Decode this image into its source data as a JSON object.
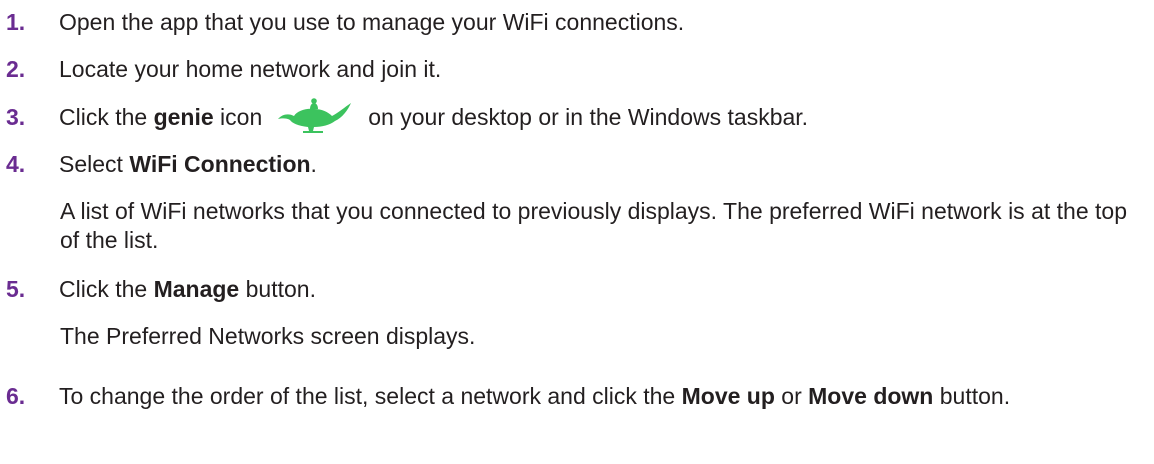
{
  "steps": [
    {
      "number": "1.",
      "text": "Open the app that you use to manage your WiFi connections."
    },
    {
      "number": "2.",
      "text": "Locate your home network and join it."
    },
    {
      "number": "3.",
      "prefix": "Click the ",
      "bold": "genie",
      "middle": " icon",
      "icon": "genie-lamp-icon",
      "suffix": "on your desktop or in the Windows taskbar."
    },
    {
      "number": "4.",
      "prefix": "Select ",
      "bold": "WiFi Connection",
      "suffix": ".",
      "note": "A list of WiFi networks that you connected to previously displays. The preferred WiFi network is at the top of the list."
    },
    {
      "number": "5.",
      "prefix": "Click the ",
      "bold": "Manage",
      "suffix": " button.",
      "note": "The Preferred Networks screen displays."
    },
    {
      "number": "6.",
      "prefix": "To change the order of the list, select a network and click the ",
      "bold1": "Move up",
      "middle": " or ",
      "bold2": "Move down",
      "suffix": " button."
    }
  ],
  "colors": {
    "step_number": "#6a2c91",
    "body_text": "#231f20",
    "genie_icon": "#3cc35e"
  }
}
